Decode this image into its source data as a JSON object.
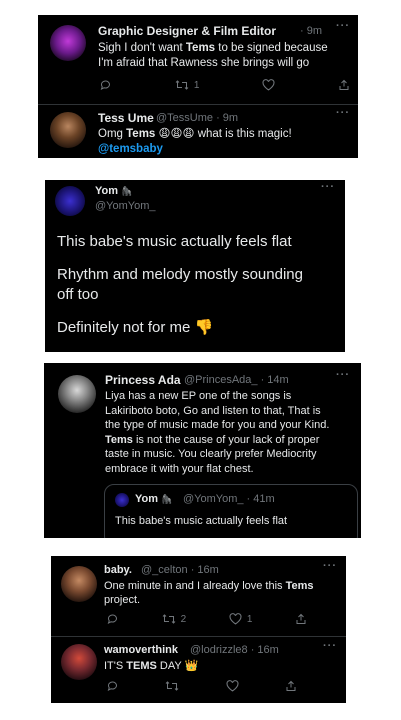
{
  "panel1": {
    "tweet1": {
      "name": "Graphic Designer & Film Editor",
      "time": "· 9m",
      "line1_pre": "Sigh I don't want ",
      "line1_bold": "Tems",
      "line1_post": " to be signed because",
      "line2": "I'm afraid that Rawness she brings will go",
      "retweets": "1"
    },
    "tweet2": {
      "name": "Tess Ume",
      "handle": "@TessUme · 9m",
      "text_pre": "Omg ",
      "text_bold": "Tems",
      "emojis": "😩😩😩",
      "text_post": " what is this magic!",
      "mention": "@temsbaby"
    }
  },
  "panel2": {
    "name": "Yom",
    "name_emoji": "🦍",
    "handle": "@YomYom_",
    "line1": "This babe's music actually feels flat",
    "line2": "Rhythm and melody mostly sounding",
    "line3": "off too",
    "line4": "Definitely not for me",
    "line4_emoji": "👎"
  },
  "panel3": {
    "name": "Princess Ada",
    "handle": "@PrincesAda_ · 14m",
    "lines": [
      "Liya has a new EP one of the songs is",
      "Lakiriboto boto,  Go and listen to that, That is",
      "the type of music made for you and your Kind."
    ],
    "line4_bold": "Tems",
    "line4_rest": " is not the cause of your lack of proper",
    "line5": "taste in music. You clearly prefer Mediocrity",
    "line6": "embrace it with your flat chest.",
    "quote": {
      "name": "Yom",
      "name_emoji": "🦍",
      "handle": "@YomYom_ · 41m",
      "text": "This babe's music actually feels flat"
    }
  },
  "panel4": {
    "tweet1": {
      "name": "baby.",
      "handle": "@_celton · 16m",
      "line1": "One minute in and I already love this ",
      "line1_bold": "Tems",
      "line2": "project.",
      "retweets": "2",
      "likes": "1"
    },
    "tweet2": {
      "name": "wamoverthink",
      "handle": "@lodrizzle8 · 16m",
      "text_pre": "IT'S ",
      "text_bold": "TEMS",
      "text_post": " DAY ",
      "emoji": "👑"
    }
  },
  "icons": {
    "reply": "reply-icon",
    "retweet": "retweet-icon",
    "like": "heart-icon",
    "share": "share-icon",
    "more": "more-options-icon"
  },
  "more_glyph": "···",
  "colors": {
    "background": "#ffffff",
    "card": "#000000",
    "text": "#e7e9ea",
    "muted": "#71767b",
    "link": "#1d9bf0"
  }
}
